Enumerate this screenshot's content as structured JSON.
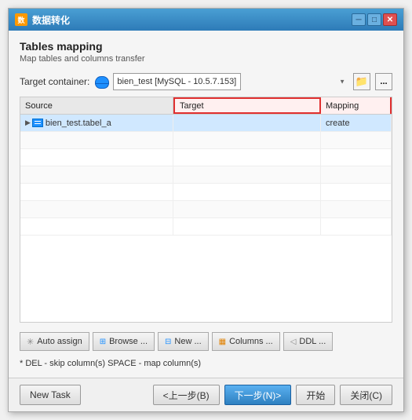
{
  "window": {
    "title": "数据转化",
    "icon": "数"
  },
  "titlebar_controls": {
    "minimize": "─",
    "maximize": "□",
    "close": "✕"
  },
  "header": {
    "title": "Tables mapping",
    "subtitle": "Map tables and columns transfer"
  },
  "target_container": {
    "label": "Target container:",
    "value": "bien_test  [MySQL - 10.5.7.153]",
    "folder_icon": "📁",
    "dots_label": "..."
  },
  "table": {
    "columns": {
      "source": "Source",
      "target": "Target",
      "mapping": "Mapping"
    },
    "rows": [
      {
        "source": "bien_test.tabel_a",
        "target": "",
        "mapping": "create",
        "highlighted": true
      }
    ],
    "empty_rows": 6
  },
  "action_buttons": [
    {
      "id": "auto-assign",
      "label": "Auto assign",
      "icon": "✳"
    },
    {
      "id": "browse",
      "label": "Browse ...",
      "icon": "⊞"
    },
    {
      "id": "new",
      "label": "New ...",
      "icon": "⊟"
    },
    {
      "id": "columns",
      "label": "Columns ...",
      "icon": "▦"
    },
    {
      "id": "ddl",
      "label": "DDL ...",
      "icon": "◁"
    }
  ],
  "hint": "* DEL - skip column(s)  SPACE - map column(s)",
  "bottom_buttons": {
    "new_task": "New Task",
    "back": "<上一步(B)",
    "next": "下一步(N)>",
    "start": "开始",
    "close": "关闭(C)"
  }
}
